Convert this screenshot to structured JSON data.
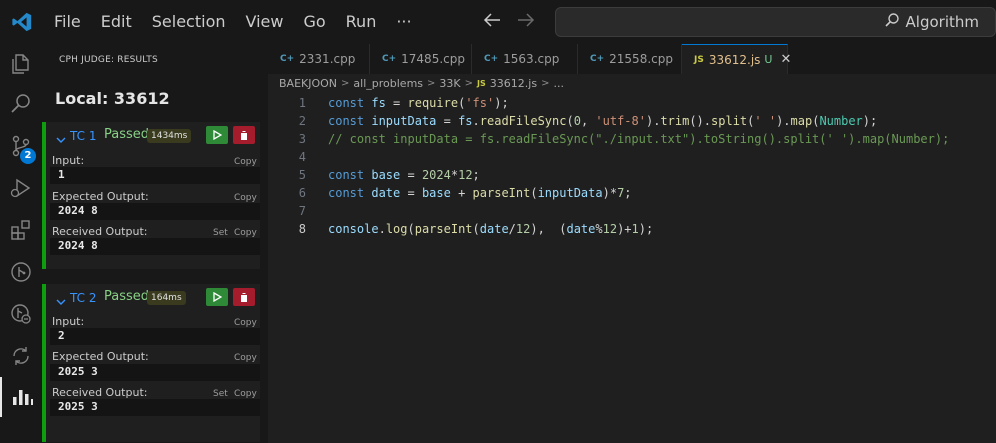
{
  "menu": [
    "File",
    "Edit",
    "Selection",
    "View",
    "Go",
    "Run",
    "···"
  ],
  "search": {
    "text": "Algorithm"
  },
  "activity": {
    "badge": "2"
  },
  "sidebar": {
    "header": "CPH JUDGE: RESULTS",
    "title": "Local: 33612",
    "testcases": [
      {
        "name": "TC 1",
        "status": "Passed",
        "time": "1434ms",
        "input_label": "Input:",
        "input": "1",
        "expected_label": "Expected Output:",
        "expected": "2024 8",
        "received_label": "Received Output:",
        "received": "2024 8",
        "copy": "Copy",
        "set": "Set"
      },
      {
        "name": "TC 2",
        "status": "Passed",
        "time": "164ms",
        "input_label": "Input:",
        "input": "2",
        "expected_label": "Expected Output:",
        "expected": "2025 3",
        "received_label": "Received Output:",
        "received": "2025 3",
        "copy": "Copy",
        "set": "Set"
      }
    ]
  },
  "tabs": [
    {
      "icon": "C+",
      "label": "2331.cpp"
    },
    {
      "icon": "C+",
      "label": "17485.cpp"
    },
    {
      "icon": "C+",
      "label": "1563.cpp"
    },
    {
      "icon": "C+",
      "label": "21558.cpp"
    },
    {
      "icon": "JS",
      "label": "33612.js",
      "modified": "U",
      "close": "✕"
    }
  ],
  "breadcrumb": [
    "BAEKJOON",
    "all_problems",
    "33K",
    "33612.js",
    "..."
  ],
  "breadcrumb_js": "JS",
  "code": {
    "line_numbers": [
      "1",
      "2",
      "3",
      "4",
      "5",
      "6",
      "7",
      "8"
    ],
    "lines": [
      [
        [
          "kw",
          "const"
        ],
        [
          "pl",
          " "
        ],
        [
          "var",
          "fs"
        ],
        [
          "pl",
          " = "
        ],
        [
          "fn",
          "require"
        ],
        [
          "pl",
          "("
        ],
        [
          "str",
          "'fs'"
        ],
        [
          "pl",
          ");"
        ]
      ],
      [
        [
          "kw",
          "const"
        ],
        [
          "pl",
          " "
        ],
        [
          "var",
          "inputData"
        ],
        [
          "pl",
          " = "
        ],
        [
          "var",
          "fs"
        ],
        [
          "pl",
          "."
        ],
        [
          "fn",
          "readFileSync"
        ],
        [
          "pl",
          "("
        ],
        [
          "num",
          "0"
        ],
        [
          "pl",
          ", "
        ],
        [
          "str",
          "'utf-8'"
        ],
        [
          "pl",
          ")."
        ],
        [
          "fn",
          "trim"
        ],
        [
          "pl",
          "()."
        ],
        [
          "fn",
          "split"
        ],
        [
          "pl",
          "("
        ],
        [
          "str",
          "' '"
        ],
        [
          "pl",
          ")."
        ],
        [
          "fn",
          "map"
        ],
        [
          "pl",
          "("
        ],
        [
          "cls",
          "Number"
        ],
        [
          "pl",
          ");"
        ]
      ],
      [
        [
          "cm",
          "// const inputData = fs.readFileSync(\"./input.txt\").toString().split(' ').map(Number);"
        ]
      ],
      [],
      [
        [
          "kw",
          "const"
        ],
        [
          "pl",
          " "
        ],
        [
          "var",
          "base"
        ],
        [
          "pl",
          " = "
        ],
        [
          "num",
          "2024"
        ],
        [
          "pl",
          "*"
        ],
        [
          "num",
          "12"
        ],
        [
          "pl",
          ";"
        ]
      ],
      [
        [
          "kw",
          "const"
        ],
        [
          "pl",
          " "
        ],
        [
          "var",
          "date"
        ],
        [
          "pl",
          " = "
        ],
        [
          "var",
          "base"
        ],
        [
          "pl",
          " + "
        ],
        [
          "fn",
          "parseInt"
        ],
        [
          "pl",
          "("
        ],
        [
          "var",
          "inputData"
        ],
        [
          "pl",
          ")*"
        ],
        [
          "num",
          "7"
        ],
        [
          "pl",
          ";"
        ]
      ],
      [],
      [
        [
          "var",
          "console"
        ],
        [
          "pl",
          "."
        ],
        [
          "fn",
          "log"
        ],
        [
          "pl",
          "("
        ],
        [
          "fn",
          "parseInt"
        ],
        [
          "pl",
          "("
        ],
        [
          "var",
          "date"
        ],
        [
          "pl",
          "/"
        ],
        [
          "num",
          "12"
        ],
        [
          "pl",
          "),  ("
        ],
        [
          "var",
          "date"
        ],
        [
          "pl",
          "%"
        ],
        [
          "num",
          "12"
        ],
        [
          "pl",
          ")+"
        ],
        [
          "num",
          "1"
        ],
        [
          "pl",
          ");"
        ]
      ]
    ]
  },
  "colors": {
    "accent": "#0078d4",
    "passed": "#89d185",
    "run_button": "#2e8a36",
    "delete_button": "#a51d2d",
    "tc_border": "#0f9d10"
  }
}
